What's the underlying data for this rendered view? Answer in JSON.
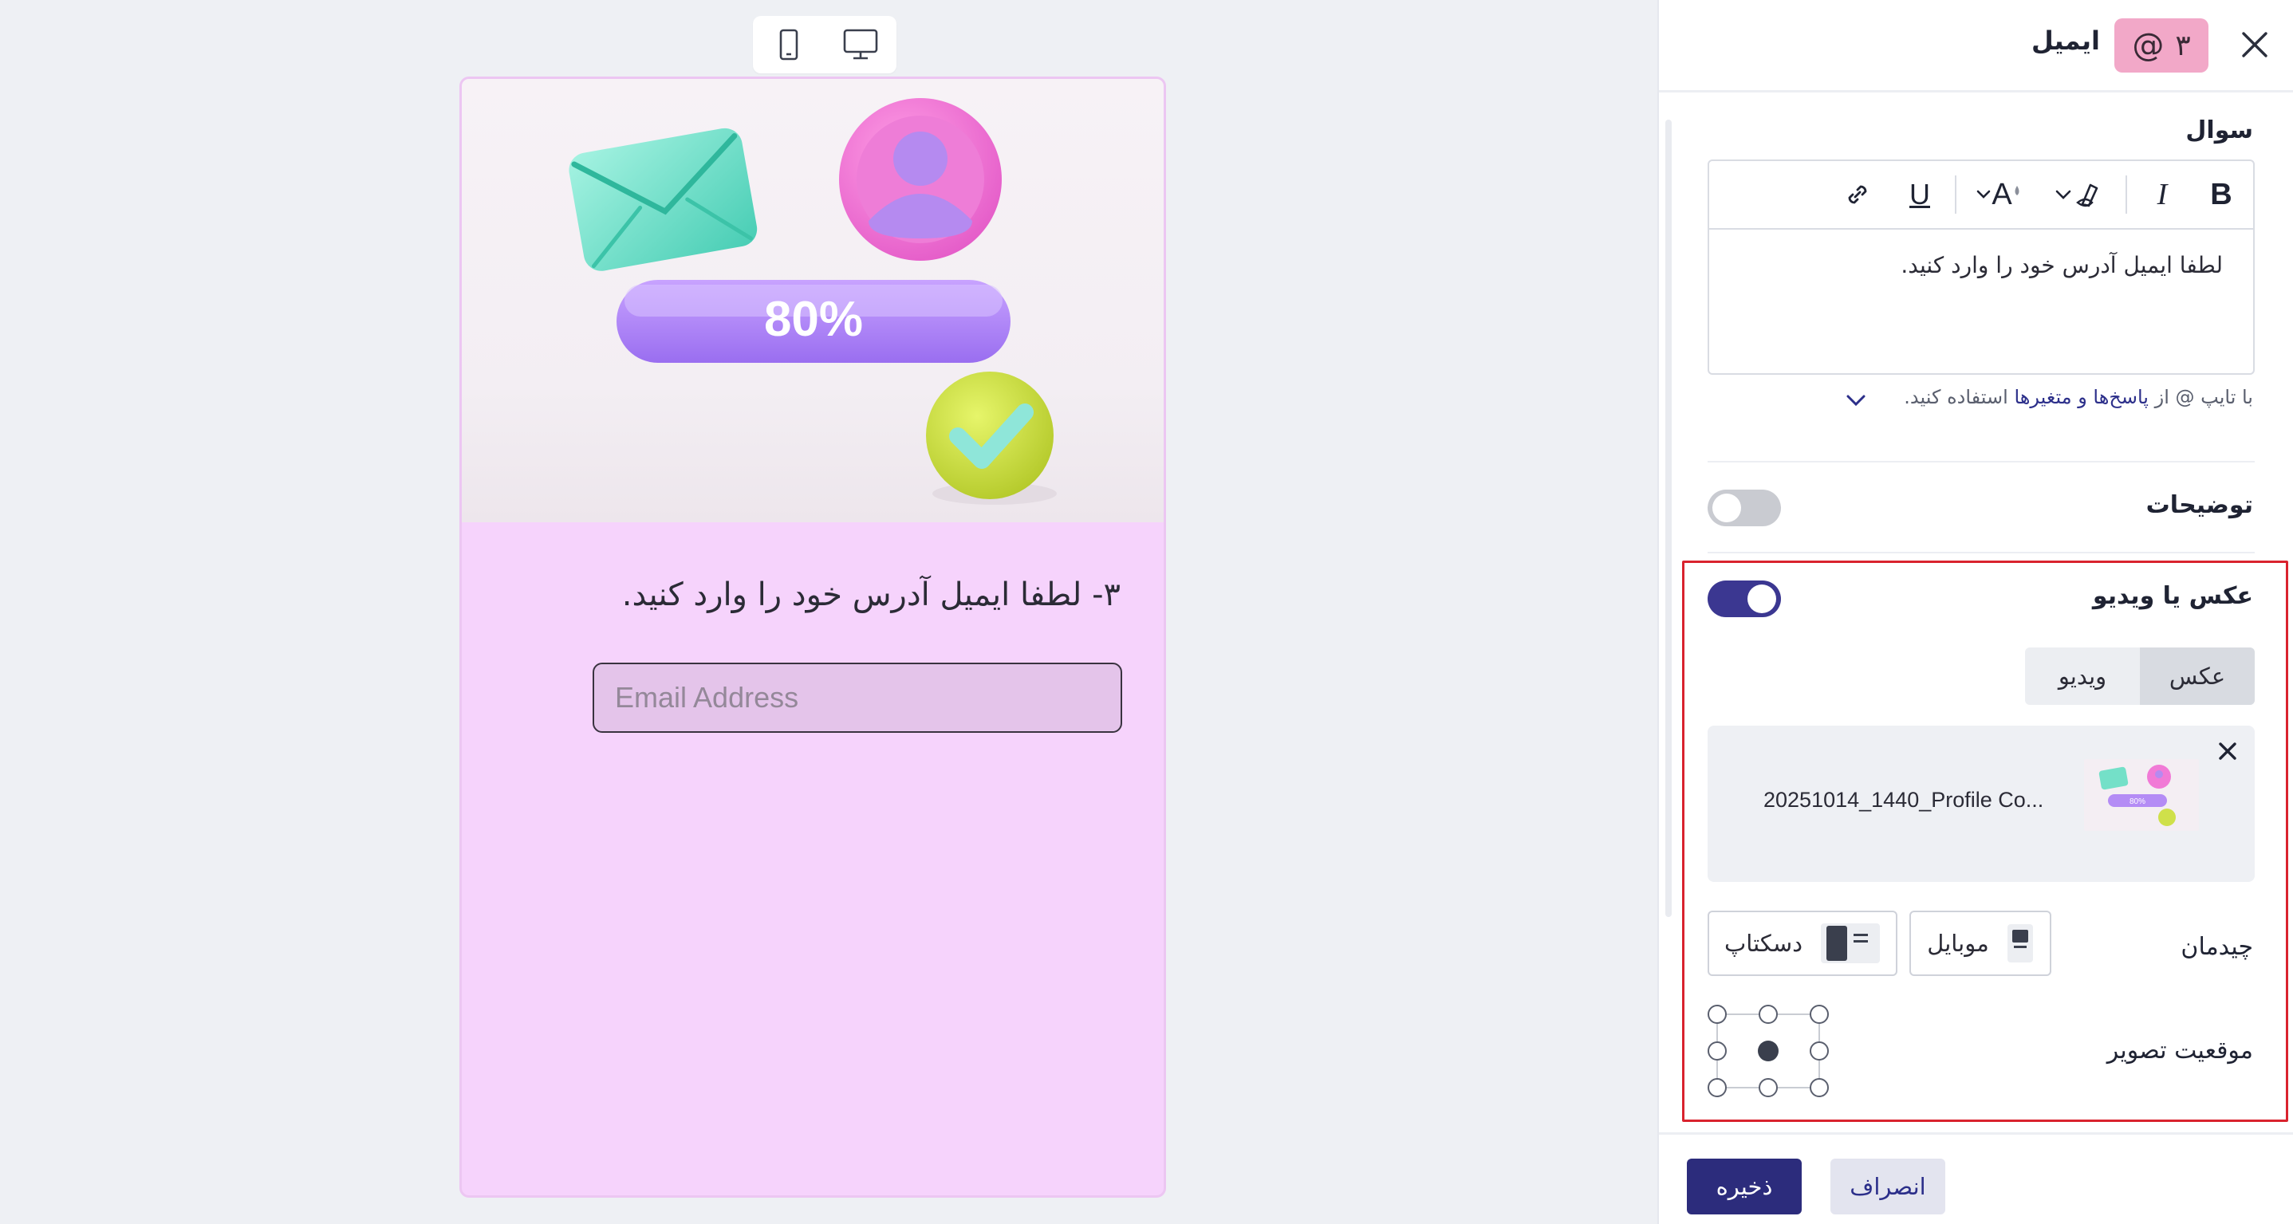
{
  "preview": {
    "device_toggle": {
      "mobile_icon": "mobile-device-icon",
      "desktop_icon": "desktop-monitor-icon"
    },
    "hero": {
      "progress_text": "80%"
    },
    "question_text": "۳- لطفا ایمیل آدرس خود را وارد کنید.",
    "email_placeholder": "Email Address"
  },
  "panel": {
    "title": "ایمیل",
    "question_number": "۳",
    "question_icon": "at-sign-icon",
    "question_section_label": "سوال",
    "toolbar": {
      "bold": "B",
      "italic": "I",
      "underline": "U",
      "font_size": "A",
      "items": [
        "bold-icon",
        "italic-icon",
        "highlight-icon",
        "font-size-icon",
        "underline-icon",
        "link-icon"
      ]
    },
    "editor_text": "لطفا ایمیل آدرس خود را وارد کنید.",
    "hint": {
      "prefix": "با تایپ @ از ",
      "link": "پاسخ‌ها و متغیرها",
      "suffix": " استفاده کنید."
    },
    "description_label": "توضیحات",
    "description_enabled": false,
    "media_label": "عکس یا ویدیو",
    "media_enabled": true,
    "media_tabs": {
      "image": "عکس",
      "video": "ویدیو",
      "active": "image"
    },
    "file": {
      "name": "20251014_1440_Profile Co..."
    },
    "layout_label": "چیدمان",
    "layout_mobile": "موبایل",
    "layout_desktop": "دسکتاپ",
    "image_position_label": "موقعیت تصویر",
    "image_position_selected": "center",
    "cancel_label": "انصراف",
    "save_label": "ذخیره"
  },
  "colors": {
    "accent": "#2c2c7c",
    "toggle_on": "#3b3791",
    "badge": "#f2a8c8",
    "preview_bg": "#f6d3fc",
    "highlight_border": "#d9232e"
  }
}
